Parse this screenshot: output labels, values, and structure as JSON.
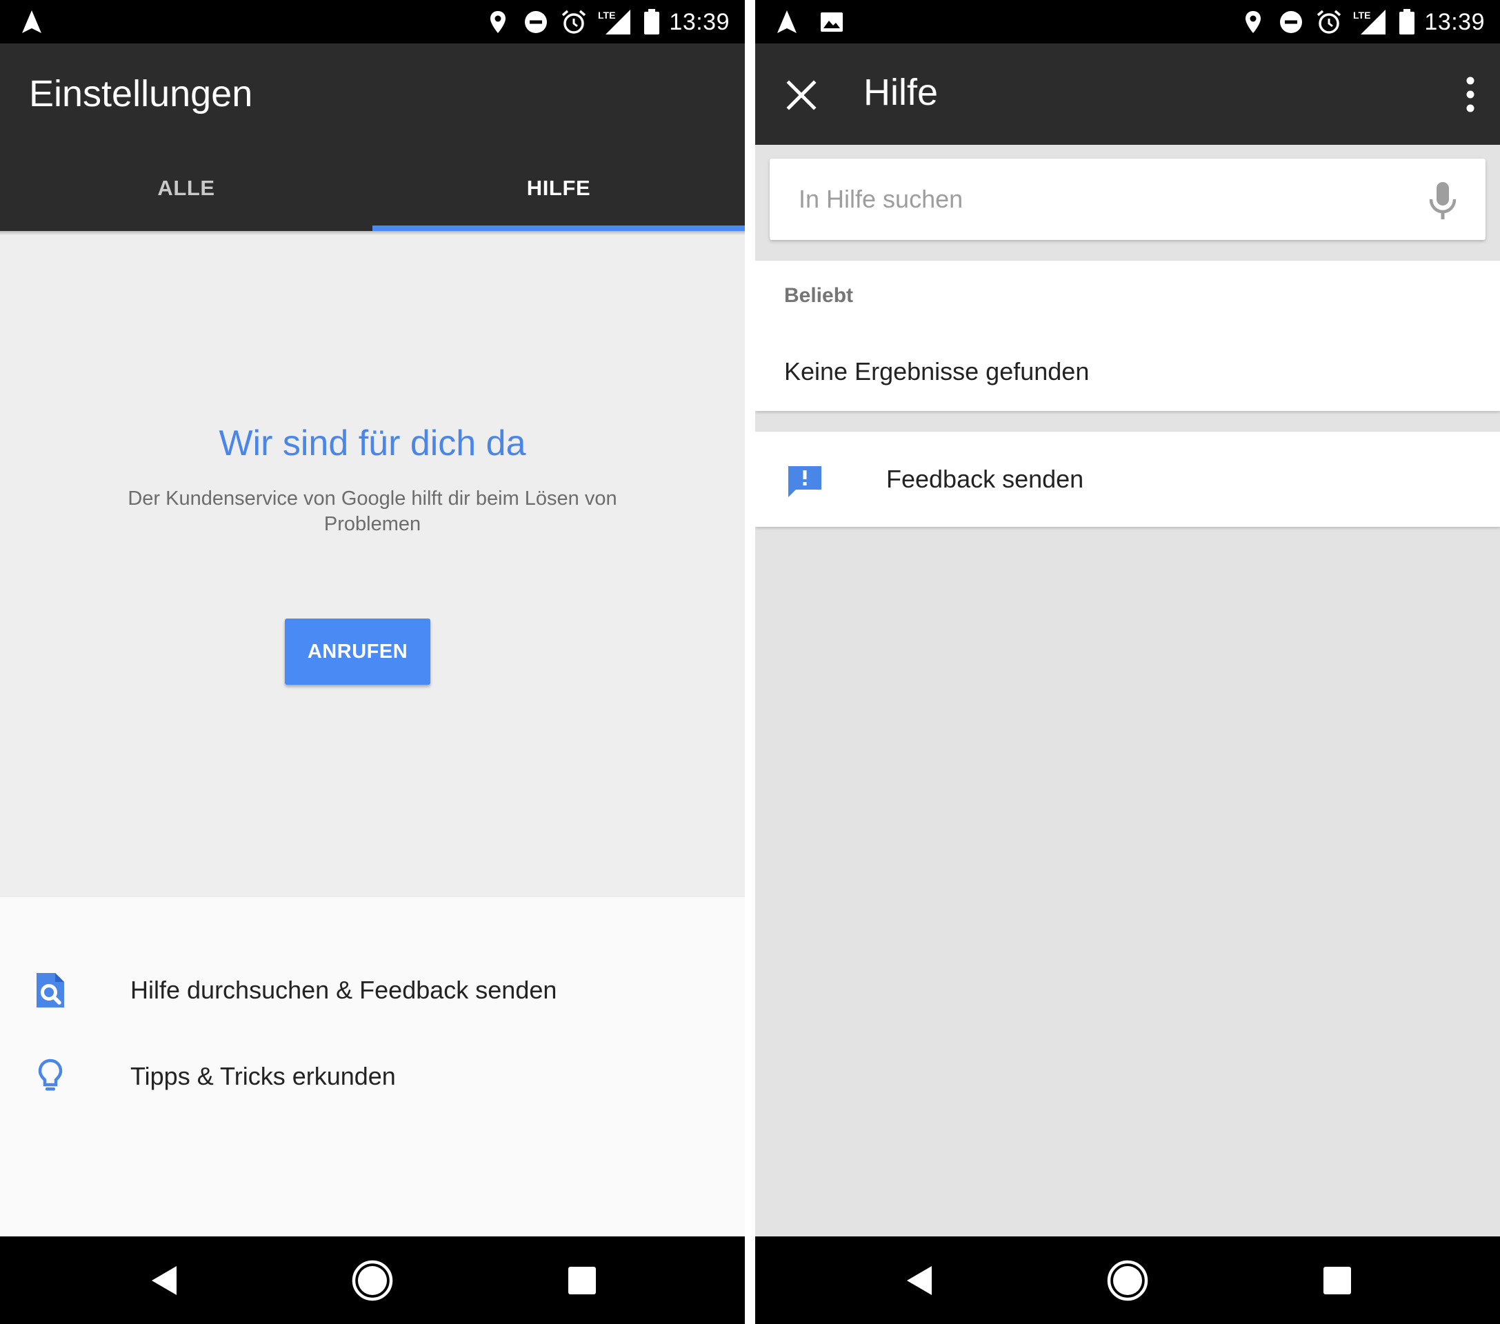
{
  "status_bar": {
    "time": "13:39",
    "network": "LTE",
    "icons": [
      "navigation-icon",
      "location-icon",
      "do-not-disturb-icon",
      "alarm-icon",
      "lte-signal-icon",
      "battery-icon"
    ],
    "right_screen_extra_icon": "image-notification-icon"
  },
  "left_screen": {
    "title": "Einstellungen",
    "tabs": [
      {
        "label": "ALLE",
        "selected": false
      },
      {
        "label": "HILFE",
        "selected": true
      }
    ],
    "hero": {
      "title": "Wir sind für dich da",
      "subtitle": "Der Kundenservice von Google hilft dir beim Lösen von Problemen",
      "call_button": "ANRUFEN"
    },
    "list": [
      {
        "icon": "search-help-icon",
        "label": "Hilfe durchsuchen & Feedback senden"
      },
      {
        "icon": "lightbulb-icon",
        "label": "Tipps & Tricks erkunden"
      }
    ]
  },
  "right_screen": {
    "title": "Hilfe",
    "close_icon": "close-icon",
    "menu_icon": "more-vert-icon",
    "search": {
      "placeholder": "In Hilfe suchen",
      "value": "",
      "icon": "mic-icon"
    },
    "popular": {
      "heading": "Beliebt",
      "empty_text": "Keine Ergebnisse gefunden"
    },
    "feedback": {
      "icon": "feedback-icon",
      "label": "Feedback senden"
    }
  },
  "nav_bar": {
    "buttons": [
      "back-icon",
      "home-icon",
      "recents-icon"
    ]
  },
  "colors": {
    "accent": "#4a8af4",
    "hero_title": "#4a86e8",
    "app_bar": "#2c2c2d",
    "status_bar": "#000000",
    "left_background": "#eeeeee",
    "right_background": "#e3e3e3"
  }
}
